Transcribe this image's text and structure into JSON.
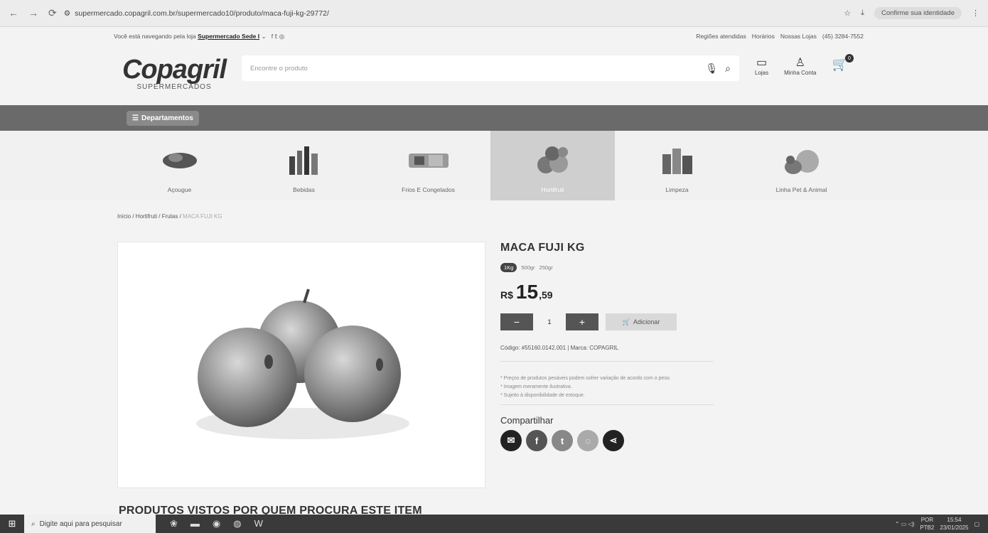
{
  "browser": {
    "url": "supermercado.copagril.com.br/supermercado10/produto/maca-fuji-kg-29772/",
    "identity_label": "Confirme sua identidade"
  },
  "topbar": {
    "store_prefix": "Você está navegando pela loja",
    "store_name": "Supermercado Sede I",
    "links": [
      "Regiões atendidas",
      "Horários",
      "Nossas Lojas",
      "(45) 3284-7552"
    ]
  },
  "header": {
    "logo_name": "Copagril",
    "logo_sub": "SUPERMERCADOS",
    "search_placeholder": "Encontre o produto",
    "stores_label": "Lojas",
    "account_label": "Minha Conta",
    "cart_count": "0"
  },
  "departments_label": "Departamentos",
  "categories": [
    {
      "label": "Açougue",
      "icon": "meat-icon"
    },
    {
      "label": "Bebidas",
      "icon": "bottles-icon"
    },
    {
      "label": "Frios E Congelados",
      "icon": "cold-cuts-icon"
    },
    {
      "label": "Hortifruti",
      "icon": "fruits-icon"
    },
    {
      "label": "Limpeza",
      "icon": "cleaning-icon"
    },
    {
      "label": "Linha Pet & Animal",
      "icon": "pets-icon"
    }
  ],
  "breadcrumb": {
    "home": "Início",
    "l1": "Hortifruti",
    "l2": "Frutas",
    "current": "MACA FUJI KG"
  },
  "product": {
    "title": "MACA FUJI KG",
    "sizes": [
      "1Kg",
      "500gr",
      "250gr"
    ],
    "currency": "R$",
    "price_int": "15",
    "price_dec": ",59",
    "quantity": "1",
    "minus": "−",
    "plus": "+",
    "add_label": "Adicionar",
    "code_line": "Código: #55160.0142.001 | Marca: COPAGRIL",
    "notes": [
      "* Preços de produtos pesáveis podem sofrer variação de acordo com o peso.",
      "* Imagem meramente ilustrativa.",
      "* Sujeito à disponibilidade de estoque."
    ],
    "share_title": "Compartilhar"
  },
  "section_title": "PRODUTOS VISTOS POR QUEM PROCURA ESTE ITEM",
  "taskbar": {
    "search_placeholder": "Digite aqui para pesquisar",
    "lang1": "POR",
    "lang2": "PTB2",
    "time": "15:54",
    "date": "23/01/2025"
  },
  "colors": {
    "dept_bar": "#6a6a6a",
    "active_category": "#cfcfcf"
  }
}
